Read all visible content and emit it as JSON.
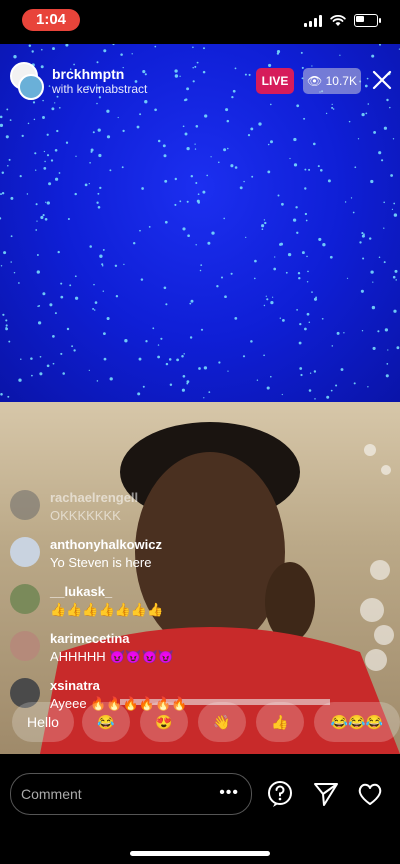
{
  "status": {
    "time": "1:04"
  },
  "header": {
    "host": "brckhmptn",
    "with_text": "with kevinabstract",
    "live_label": "LIVE",
    "viewers": "10.7K"
  },
  "comments": [
    {
      "user": "rachaelrengell",
      "text": "OKKKKKKK"
    },
    {
      "user": "anthonyhalkowicz",
      "text": "Yo Steven is here"
    },
    {
      "user": "__lukask_",
      "text": "👍👍👍👍👍👍👍"
    },
    {
      "user": "karimecetina",
      "text": "AHHHHH 😈😈😈😈"
    },
    {
      "user": "xsinatra",
      "text": "Ayeee 🔥🔥🔥🔥🔥🔥"
    }
  ],
  "quick_replies": [
    "Hello",
    "😂",
    "😍",
    "👋",
    "👍",
    "😂😂😂"
  ],
  "footer": {
    "comment_placeholder": "Comment",
    "more_dots": "•••"
  }
}
